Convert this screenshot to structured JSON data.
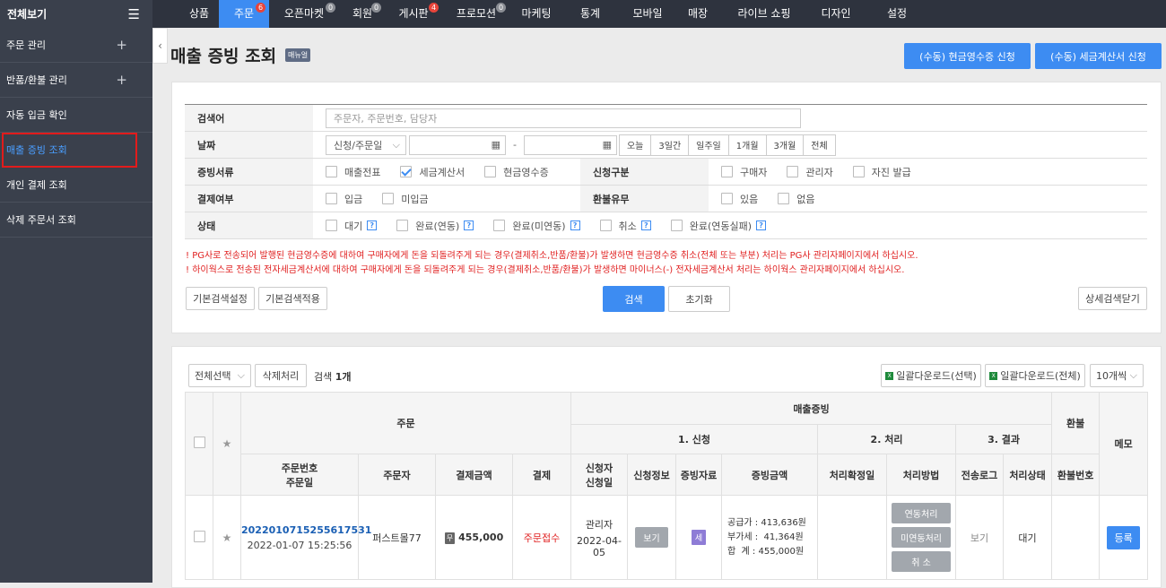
{
  "sidebar": {
    "header": "전체보기",
    "items": [
      {
        "label": "주문 관리",
        "plus": "+"
      },
      {
        "label": "반품/환불 관리",
        "plus": "+"
      },
      {
        "label": "자동 입금 확인"
      },
      {
        "label": "매출 증빙 조회"
      },
      {
        "label": "개인 결제 조회"
      },
      {
        "label": "삭제 주문서 조회"
      }
    ]
  },
  "topnav": {
    "tabs": [
      {
        "label": "상품"
      },
      {
        "label": "주문",
        "badge": "6"
      },
      {
        "label": "오픈마켓",
        "badge": "0"
      },
      {
        "label": "회원",
        "badge": "0"
      },
      {
        "label": "게시판",
        "badge": "4"
      },
      {
        "label": "프로모션",
        "badge": "0"
      },
      {
        "label": "마케팅"
      },
      {
        "label": "통계"
      },
      {
        "label": "모바일"
      },
      {
        "label": "매장"
      },
      {
        "label": "라이브 쇼핑"
      },
      {
        "label": "디자인"
      },
      {
        "label": "설정"
      }
    ]
  },
  "page": {
    "title": "매출 증빙 조회",
    "manual": "매뉴얼",
    "btn_cash": "(수동) 현금영수증 신청",
    "btn_tax": "(수동) 세금계산서 신청"
  },
  "search": {
    "keyword_label": "검색어",
    "keyword_placeholder": "주문자, 주문번호, 담당자",
    "date_label": "날짜",
    "date_select": "신청/주문일",
    "date_dash": "-",
    "periods": [
      "오늘",
      "3일간",
      "일주일",
      "1개월",
      "3개월",
      "전체"
    ],
    "doc_label": "증빙서류",
    "docs": [
      "매출전표",
      "세금계산서",
      "현금영수증"
    ],
    "req_label": "신청구분",
    "reqs": [
      "구매자",
      "관리자",
      "자진 발급"
    ],
    "pay_label": "결제여부",
    "pays": [
      "입금",
      "미입금"
    ],
    "refund_label": "환불유무",
    "refunds": [
      "있음",
      "없음"
    ],
    "status_label": "상태",
    "statuses": [
      "대기",
      "완료(연동)",
      "완료(미연동)",
      "취소",
      "완료(연동실패)"
    ],
    "notice1": "! PG사로 전송되어 발행된 현금영수증에 대하여 구매자에게 돈을 되돌려주게 되는 경우(결제취소,반품/환불)가 발생하면 현금영수증 취소(전체 또는 부분) 처리는 PG사 관리자페이지에서 하십시오.",
    "notice2": "! 하이웍스로 전송된 전자세금계산서에 대하여 구매자에게 돈을 되돌려주게 되는 경우(결제취소,반품/환불)가 발생하면 마이너스(-) 전자세금계산서 처리는 하이웍스 관리자페이지에서 하십시오.",
    "btn_basic_set": "기본검색설정",
    "btn_basic_apply": "기본검색적용",
    "btn_search": "검색",
    "btn_reset": "초기화",
    "btn_detail_close": "상세검색닫기"
  },
  "list": {
    "select_all": "전체선택",
    "delete": "삭제처리",
    "count_prefix": "검색",
    "count": "1개",
    "dl_selected": "일괄다운로드(선택)",
    "dl_all": "일괄다운로드(전체)",
    "per_page": "10개씩",
    "headers": {
      "order": "주문",
      "proof": "매출증빙",
      "refund": "환불",
      "memo": "메모",
      "step1": "1. 신청",
      "step2": "2. 처리",
      "step3": "3. 결과",
      "order_no": "주문번호",
      "order_date": "주문일",
      "orderer": "주문자",
      "amount": "결제금액",
      "payment": "결제",
      "applicant": "신청자",
      "apply_date": "신청일",
      "apply_info": "신청정보",
      "proof_doc": "증빙자료",
      "proof_amount": "증빙금액",
      "process_date": "처리확정일",
      "process_method": "처리방법",
      "send_log": "전송로그",
      "process_status": "처리상태",
      "refund_no": "환불번호"
    },
    "rows": [
      {
        "order_no": "2022010715255617531",
        "order_date": "2022-01-07 15:25:56",
        "orderer": "퍼스트몰77",
        "pay_icon": "무",
        "amount": "455,000",
        "payment": "주문접수",
        "applicant": "관리자",
        "apply_date": "2022-04-05",
        "view": "보기",
        "doc": "세",
        "supply": "공급가 : 413,636원",
        "vat": "부가세 :  41,364원",
        "total": "합  계 : 455,000원",
        "m1": "연동처리",
        "m2": "미연동처리",
        "m3": "취 소",
        "send_log": "보기",
        "status": "대기",
        "register": "등록"
      }
    ]
  },
  "colors": {
    "accent": "#3d8cf2",
    "sidebar_bg": "#3a404c",
    "topbar_bg": "#2e333e",
    "alert": "#e02020"
  }
}
